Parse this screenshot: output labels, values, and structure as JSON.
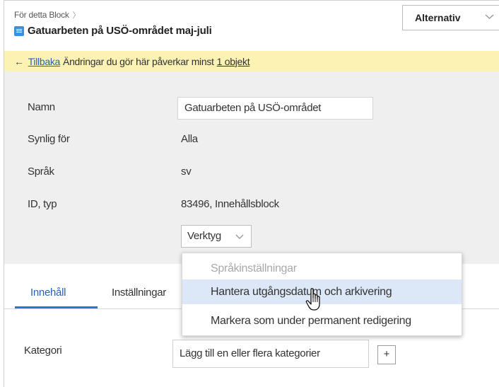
{
  "header": {
    "breadcrumb": "För detta Block",
    "title": "Gatuarbeten på USÖ-området maj-juli",
    "options_button": "Alternativ"
  },
  "notice": {
    "back_link": "Tillbaka",
    "text": "Ändringar du gör här påverkar minst",
    "objects_link": "1 objekt"
  },
  "properties": {
    "name_label": "Namn",
    "name_value": "Gatuarbeten på USÖ-området",
    "visible_label": "Synlig för",
    "visible_value": "Alla",
    "language_label": "Språk",
    "language_value": "sv",
    "id_label": "ID, typ",
    "id_value": "83496, Innehållsblock",
    "tools_button": "Verktyg"
  },
  "tools_menu": {
    "items": [
      {
        "label": "Språkinställningar",
        "disabled": true
      },
      {
        "label": "Hantera utgångsdatum och arkivering",
        "hovered": true
      },
      {
        "label": "Markera som under permanent redigering"
      }
    ]
  },
  "tabs": [
    {
      "label": "Innehåll",
      "active": true
    },
    {
      "label": "Inställningar"
    }
  ],
  "category": {
    "label": "Kategori",
    "field_text": "Lägg till en eller flera kategorier",
    "add_button": "+"
  },
  "colors": {
    "notice_bg": "#fbf2b4",
    "panel_bg": "#efefef",
    "accent": "#2b74d4",
    "menu_hover": "#dce7f7"
  }
}
